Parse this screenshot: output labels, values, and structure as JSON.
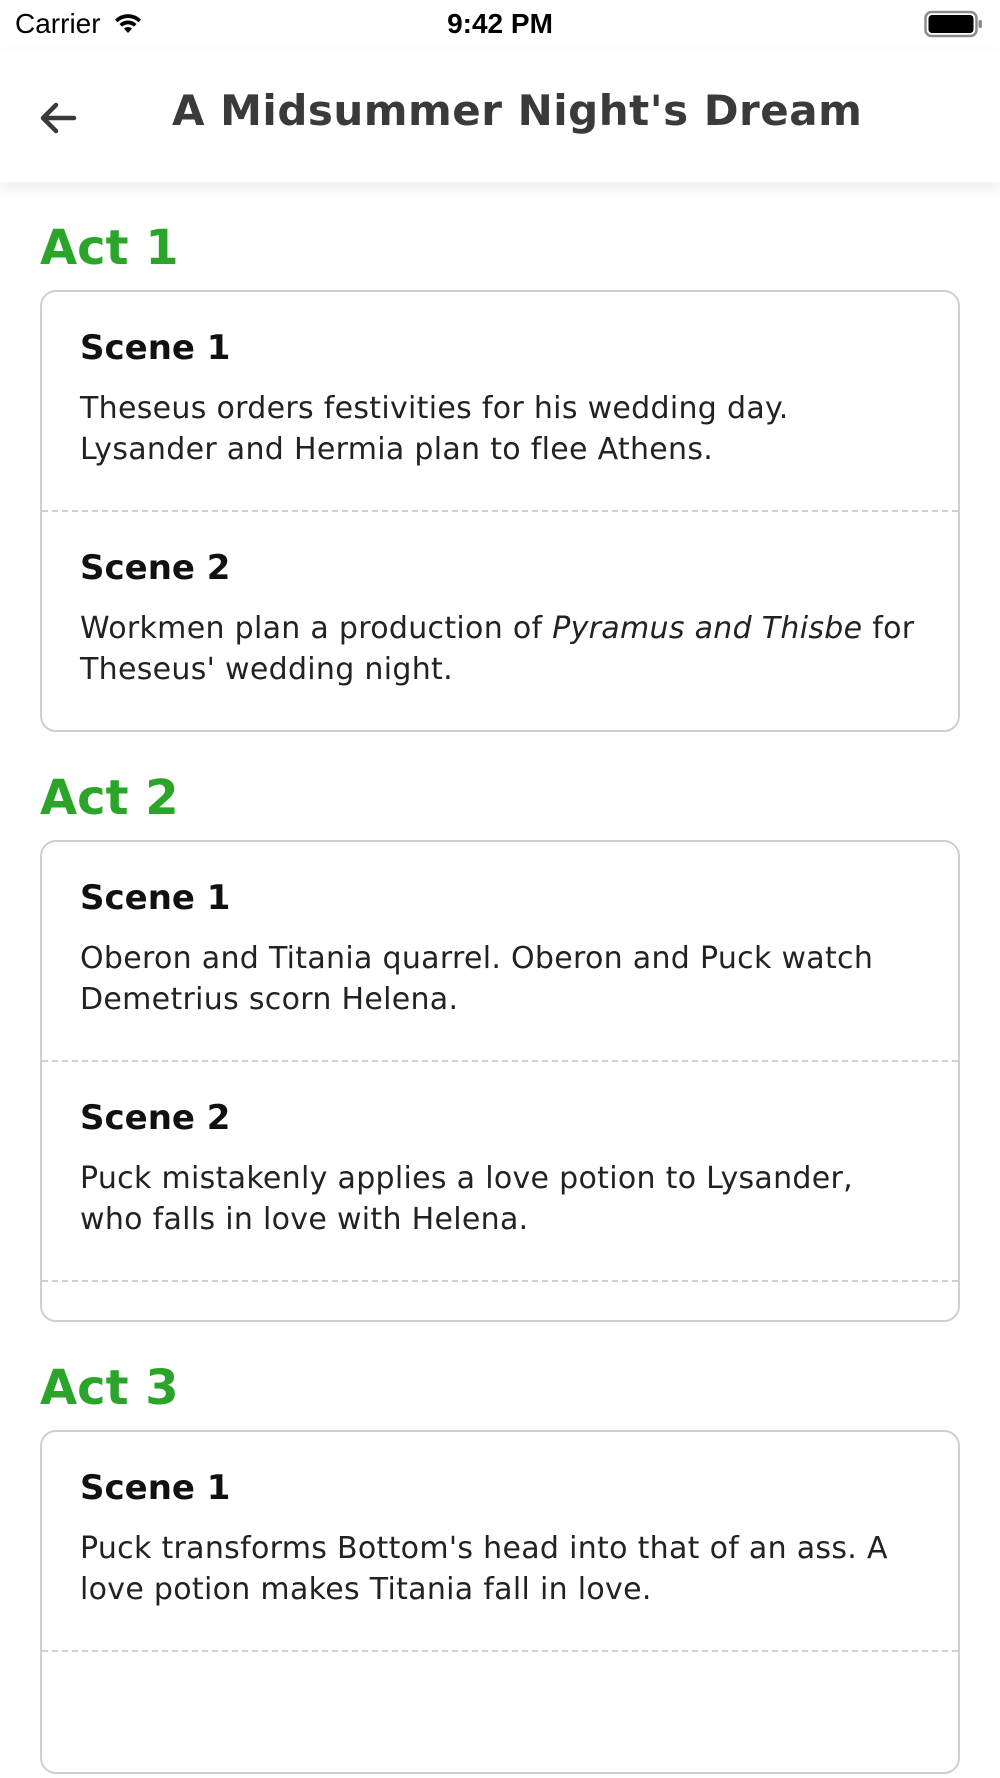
{
  "status_bar": {
    "carrier": "Carrier",
    "time": "9:42 PM"
  },
  "nav": {
    "title": "A Midsummer Night's Dream",
    "back_icon": "arrow-left-icon"
  },
  "colors": {
    "act_title": "#2aa52a",
    "card_border": "#cfcfcf",
    "nav_title": "#3a3a3a"
  },
  "acts": [
    {
      "title": "Act 1",
      "scenes": [
        {
          "title": "Scene 1",
          "desc": "Theseus orders festivities for his wedding day. Lysander and Hermia plan to flee Athens."
        },
        {
          "title": "Scene 2",
          "desc_before": "Workmen plan a production of ",
          "desc_italic": "Pyramus and Thisbe",
          "desc_after": " for Theseus' wedding night."
        }
      ]
    },
    {
      "title": "Act 2",
      "scenes": [
        {
          "title": "Scene 1",
          "desc": "Oberon and Titania quarrel. Oberon and Puck watch Demetrius scorn Helena."
        },
        {
          "title": "Scene 2",
          "desc": "Puck mistakenly applies a love potion to Lysander, who falls in love with Helena."
        }
      ]
    },
    {
      "title": "Act 3",
      "scenes": [
        {
          "title": "Scene 1",
          "desc": "Puck transforms Bottom's head into that of an ass. A love potion makes Titania fall in love."
        }
      ]
    }
  ]
}
